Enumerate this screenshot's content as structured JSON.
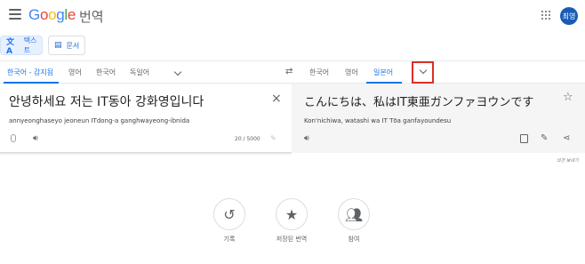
{
  "header": {
    "logo": "Google",
    "product": "번역",
    "avatar_text": "최영"
  },
  "mode_tabs": {
    "text": "텍스트",
    "document": "문서"
  },
  "source_languages": [
    "한국어 - 감지됨",
    "영어",
    "한국어",
    "독일어"
  ],
  "target_languages": [
    "한국어",
    "영어",
    "일본어"
  ],
  "source": {
    "text": "안녕하세요 저는 IT동아 강화영입니다",
    "romanization": "annyeonghaseyo jeoneun ITdong-a ganghwayeong-ibnida",
    "char_count": "20 / 5000"
  },
  "target": {
    "text": "こんにちは、私はIT東亜ガンファヨウンです",
    "romanization": "Kon'nichiwa, watashi wa IT Tōa ganfayoundesu"
  },
  "feedback": "의견 보내기",
  "bottom_actions": [
    {
      "label": "기록"
    },
    {
      "label": "저장된 번역"
    },
    {
      "label": "참여"
    }
  ]
}
